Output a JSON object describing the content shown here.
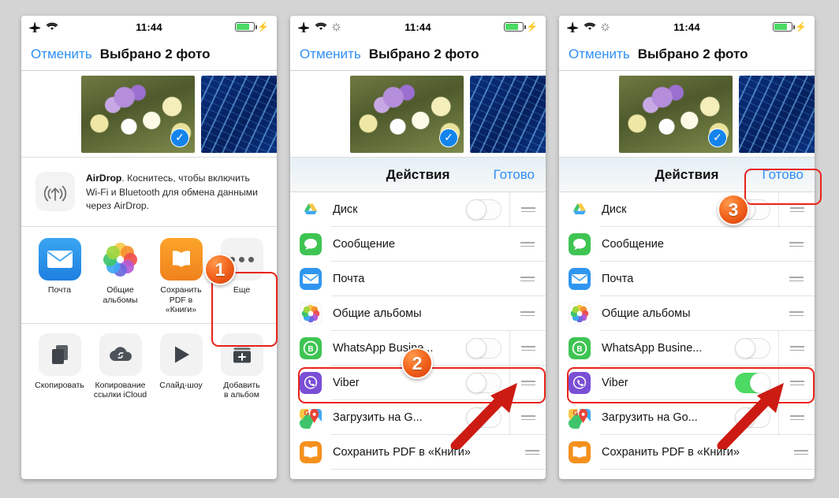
{
  "status_bar": {
    "time": "11:44",
    "icons_left": [
      "airplane-icon",
      "wifi-icon"
    ],
    "icons_left_sheet": [
      "airplane-icon",
      "wifi-icon",
      "activity-spinner-icon"
    ],
    "battery_percent": 74,
    "battery_color": "#4cd964",
    "charging_icon": "bolt-icon"
  },
  "navbar": {
    "cancel_label": "Отменить",
    "title": "Выбрано 2 фото",
    "accent_color": "#2f8ff5"
  },
  "photos": [
    {
      "name": "crocus-flowers-photo",
      "selected": true,
      "badge": "check-icon"
    },
    {
      "name": "blue-circuit-photo",
      "selected": false,
      "badge": "empty-circle-icon"
    }
  ],
  "airdrop": {
    "icon": "airdrop-icon",
    "title": "AirDrop",
    "text": ". Коснитесь, чтобы включить Wi-Fi и Bluetooth для обмена данными через AirDrop."
  },
  "share_apps": [
    {
      "label": "Почта",
      "icon": "mail-icon"
    },
    {
      "label": "Общие\nальбомы",
      "icon": "photos-icon"
    },
    {
      "label": "Сохранить\nPDF в «Книги»",
      "icon": "books-icon"
    },
    {
      "label": "Еще",
      "icon": "more-dots-icon"
    }
  ],
  "share_actions": [
    {
      "label": "Скопировать",
      "icon": "copy-icon"
    },
    {
      "label": "Копирование\nссылки iCloud",
      "icon": "icloud-link-icon"
    },
    {
      "label": "Слайд-шоу",
      "icon": "play-icon"
    },
    {
      "label": "Добавить\nв альбом",
      "icon": "add-to-album-icon"
    }
  ],
  "sheet": {
    "title": "Действия",
    "done_label": "Готово",
    "done_color": "#2f8ff5"
  },
  "activity_rows": [
    {
      "label": "Диск",
      "icon": "google-drive-icon",
      "toggle": "off"
    },
    {
      "label": "Сообщение",
      "icon": "messages-icon",
      "toggle": "none"
    },
    {
      "label": "Почта",
      "icon": "mail-icon",
      "toggle": "none"
    },
    {
      "label": "Общие альбомы",
      "icon": "photos-icon",
      "toggle": "none"
    },
    {
      "label": "WhatsApp Busine...",
      "icon": "whatsapp-business-icon",
      "toggle": "off"
    },
    {
      "label": "Viber",
      "icon": "viber-icon",
      "toggle": "off"
    },
    {
      "label": "Загрузить на G...",
      "icon": "google-maps-icon",
      "toggle": "off"
    },
    {
      "label": "Сохранить PDF в «Книги»",
      "icon": "books-icon",
      "toggle": "none"
    }
  ],
  "activity_rows_panel3": [
    {
      "label": "Диск",
      "icon": "google-drive-icon",
      "toggle": "off"
    },
    {
      "label": "Сообщение",
      "icon": "messages-icon",
      "toggle": "none"
    },
    {
      "label": "Почта",
      "icon": "mail-icon",
      "toggle": "none"
    },
    {
      "label": "Общие альбомы",
      "icon": "photos-icon",
      "toggle": "none"
    },
    {
      "label": "WhatsApp Busine...",
      "icon": "whatsapp-business-icon",
      "toggle": "off"
    },
    {
      "label": "Viber",
      "icon": "viber-icon",
      "toggle": "on"
    },
    {
      "label": "Загрузить на Go...",
      "icon": "google-maps-icon",
      "toggle": "off"
    },
    {
      "label": "Сохранить PDF в «Книги»",
      "icon": "books-icon",
      "toggle": "none"
    }
  ],
  "annotations": {
    "badge1": "1",
    "badge2": "2",
    "badge3": "3",
    "highlight_color": "#e8231a",
    "badge_color": "#f4671f",
    "arrow_color": "#cc1b13"
  }
}
